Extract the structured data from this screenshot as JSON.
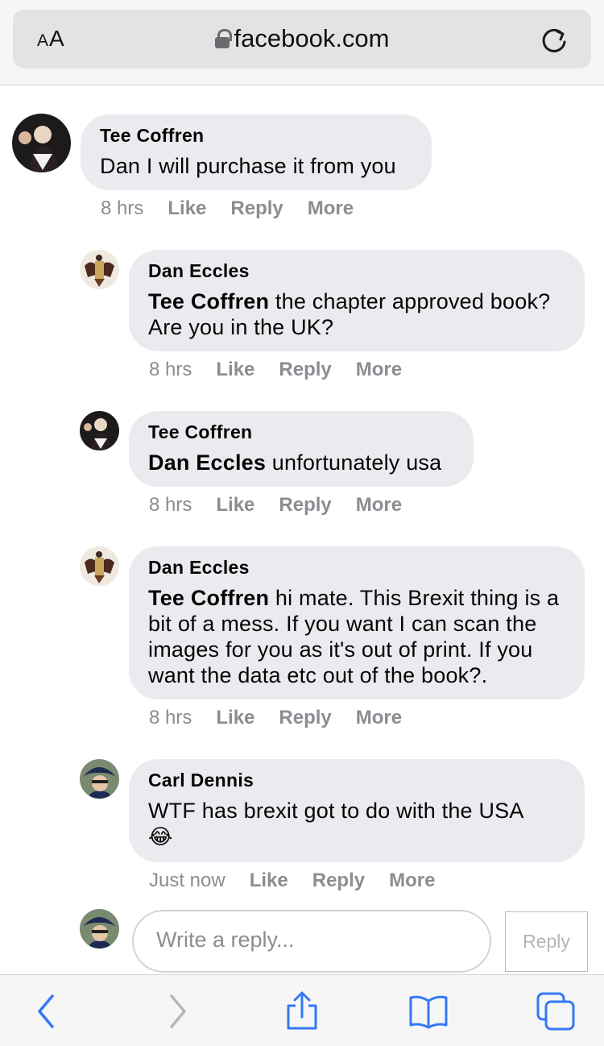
{
  "browser": {
    "text_size_label_small": "A",
    "text_size_label_large": "A",
    "url": "facebook.com",
    "icons": [
      "lock-icon",
      "reload-icon"
    ]
  },
  "comments": [
    {
      "author": "Tee Coffren",
      "mention": "",
      "text": "Dan I will purchase it from you",
      "time": "8 hrs",
      "like": "Like",
      "reply": "Reply",
      "more": "More"
    },
    {
      "author": "Dan Eccles",
      "mention": "Tee Coffren",
      "text": " the chapter approved book? Are you in the UK?",
      "time": "8 hrs",
      "like": "Like",
      "reply": "Reply",
      "more": "More"
    },
    {
      "author": "Tee Coffren",
      "mention": "Dan Eccles",
      "text": " unfortunately usa",
      "time": "8 hrs",
      "like": "Like",
      "reply": "Reply",
      "more": "More"
    },
    {
      "author": "Dan Eccles",
      "mention": "Tee Coffren",
      "text": " hi mate. This Brexit thing is a bit of a mess. If you want I can scan the images for you as it's out of print. If you want the data etc out of the book?.",
      "time": "8 hrs",
      "like": "Like",
      "reply": "Reply",
      "more": "More"
    },
    {
      "author": "Carl Dennis",
      "mention": "",
      "text": "WTF has brexit got to do with the USA",
      "emoji": "😂",
      "time": "Just now",
      "like": "Like",
      "reply": "Reply",
      "more": "More"
    }
  ],
  "composer": {
    "placeholder": "Write a reply...",
    "value": "",
    "submit_label": "Reply"
  },
  "toolbar": {
    "icons": [
      "back-icon",
      "forward-icon",
      "share-icon",
      "bookmarks-icon",
      "tabs-icon"
    ],
    "accent": "#3478f6",
    "disabled": "#b6b6ba"
  }
}
